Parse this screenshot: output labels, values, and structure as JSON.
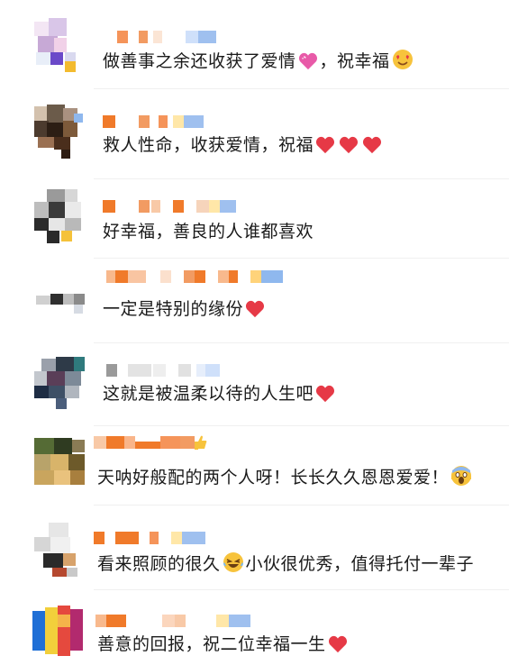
{
  "colors": {
    "heart": "#e63946",
    "pink_heart": "#e85aa8",
    "emoji_face": "#f7c33c",
    "text": "#1a1a1a",
    "name_orange": "#f07a2a",
    "name_blue": "#8fb8ee"
  },
  "comments": [
    {
      "text_before": "做善事之余还收获了爱情",
      "emoji": "pink-heart-icon",
      "text_after": "，祝幸福",
      "end_emoji": "heart-eyes-face-icon"
    },
    {
      "text_before": "救人性命，收获爱情，祝福",
      "emoji": "heart-icon x3"
    },
    {
      "text_before": "好幸福，善良的人谁都喜欢"
    },
    {
      "text_before": "一定是特别的缘份",
      "emoji": "heart-icon"
    },
    {
      "text_before": "这就是被温柔以待的人生吧",
      "emoji": "heart-icon"
    },
    {
      "text_before": "天呐好般配的两个人呀！长长久久恩恩爱爱！",
      "emoji": "screaming-face-icon"
    },
    {
      "text_before": "看来照顾的很久",
      "emoji": "laughing-face-icon",
      "text_after": "小伙很优秀，值得托付一辈子"
    },
    {
      "text_before": "善意的回报，祝二位幸福一生",
      "emoji": "heart-icon"
    }
  ]
}
